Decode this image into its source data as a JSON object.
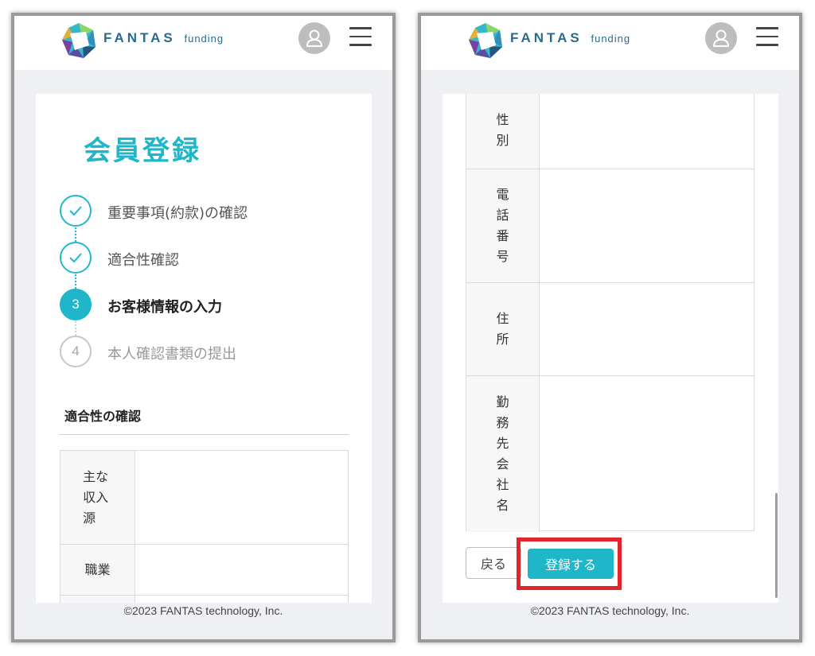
{
  "brand": {
    "name": "FANTAS",
    "sub": "funding"
  },
  "footer": "©2023 FANTAS technology, Inc.",
  "left": {
    "title": "会員登録",
    "steps": [
      {
        "number": "",
        "label": "重要事項(約款)の確認",
        "state": "done"
      },
      {
        "number": "",
        "label": "適合性確認",
        "state": "done"
      },
      {
        "number": "3",
        "label": "お客様情報の入力",
        "state": "active"
      },
      {
        "number": "4",
        "label": "本人確認書類の提出",
        "state": "pending"
      }
    ],
    "section_title": "適合性の確認",
    "rows": [
      {
        "label": "主な収入源",
        "value": ""
      },
      {
        "label": "職業",
        "value": ""
      }
    ]
  },
  "right": {
    "rows": [
      {
        "label": "性別",
        "value": ""
      },
      {
        "label": "電話番号",
        "value": ""
      },
      {
        "label": "住所",
        "value": ""
      },
      {
        "label": "勤務先会社名",
        "value": ""
      }
    ],
    "back_label": "戻る",
    "submit_label": "登録する"
  },
  "colors": {
    "accent": "#1fb6c9",
    "highlight": "#e3242b",
    "brand_text": "#2a6a8c"
  }
}
